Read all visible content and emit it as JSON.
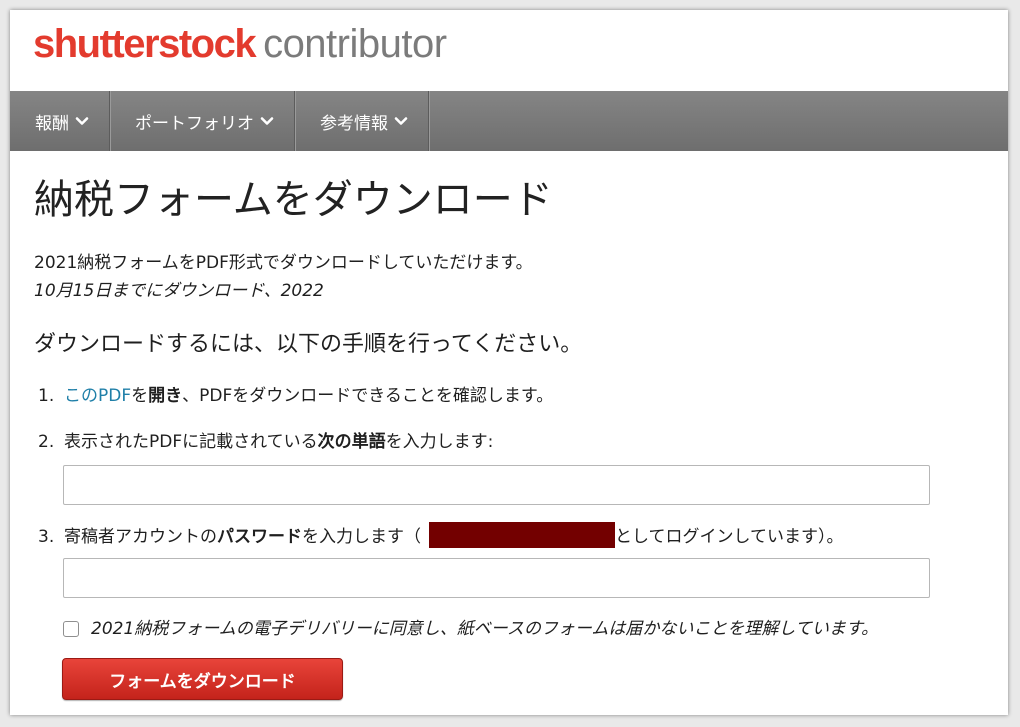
{
  "header": {
    "logo_brand": "shutterstock",
    "logo_sub": "contributor"
  },
  "nav": {
    "items": [
      {
        "label": "報酬"
      },
      {
        "label": "ポートフォリオ"
      },
      {
        "label": "参考情報"
      }
    ]
  },
  "main": {
    "title": "納税フォームをダウンロード",
    "intro": "2021納税フォームをPDF形式でダウンロードしていただけます。",
    "deadline": "10月15日までにダウンロード、2022",
    "steps_heading": "ダウンロードするには、以下の手順を行ってください。",
    "step1": {
      "num": "1.",
      "link": "このPDF",
      "text_a": "を",
      "bold": "開き",
      "text_b": "、PDFをダウンロードできることを確認します。"
    },
    "step2": {
      "num": "2.",
      "text_a": "表示されたPDFに記載されている",
      "bold": "次の単語",
      "text_b": "を入力します:",
      "input_value": ""
    },
    "step3": {
      "num": "3.",
      "text_a": "寄稿者アカウントの",
      "bold": "パスワード",
      "text_b": "を入力します（",
      "text_c": "としてログインしています）。",
      "input_value": ""
    },
    "consent_label": "2021納税フォームの電子デリバリーに同意し、紙ベースのフォームは届かないことを理解しています。",
    "download_button": "フォームをダウンロード"
  },
  "colors": {
    "brand_red": "#e33b2e",
    "link_blue": "#1f7fa8",
    "nav_gray": "#7a7a7a",
    "redaction": "#730000"
  }
}
